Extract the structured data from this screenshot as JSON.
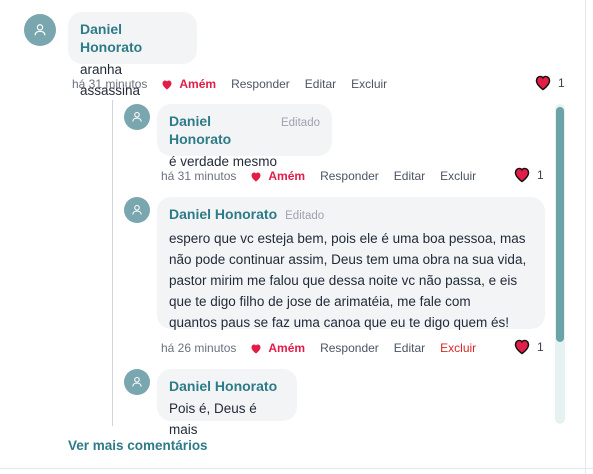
{
  "comments": [
    {
      "author": "Daniel Honorato",
      "edited_label": "",
      "text": "aranha assassina",
      "time": "há 31 minutos",
      "amem_label": "Amém",
      "reply_label": "Responder",
      "edit_label": "Editar",
      "delete_label": "Excluir",
      "likes": "1"
    }
  ],
  "replies": [
    {
      "author": "Daniel Honorato",
      "edited_label": "Editado",
      "text_lines": [
        "é verdade mesmo"
      ],
      "time": "há 31 minutos",
      "amem_label": "Amém",
      "reply_label": "Responder",
      "edit_label": "Editar",
      "delete_label": "Excluir",
      "likes": "1"
    },
    {
      "author": "Daniel Honorato",
      "edited_label": "Editado",
      "text_lines": [
        "espero que vc esteja bem, pois ele é uma boa pessoa, mas",
        "não pode continuar assim, Deus tem uma obra na sua vida,",
        "pastor mirim me falou que dessa noite vc não passa, e eis",
        "que te digo filho de jose de arimatéia, me fale com",
        "quantos paus se faz uma canoa que eu te digo quem és!"
      ],
      "time": "há 26 minutos",
      "amem_label": "Amém",
      "reply_label": "Responder",
      "edit_label": "Editar",
      "delete_label": "Excluir",
      "likes": "1"
    },
    {
      "author": "Daniel Honorato",
      "edited_label": "",
      "text_lines": [
        "Pois é, Deus é mais"
      ]
    }
  ],
  "footer": {
    "more_comments_label": "Ver mais comentários"
  },
  "colors": {
    "accent": "#2e7b88",
    "heart": "#e11d48",
    "danger": "#dc2626",
    "avatar": "#7aa6b0"
  },
  "icons": {
    "avatar": "user-icon",
    "amem": "heart-icon",
    "likes": "heart-outline-icon"
  }
}
